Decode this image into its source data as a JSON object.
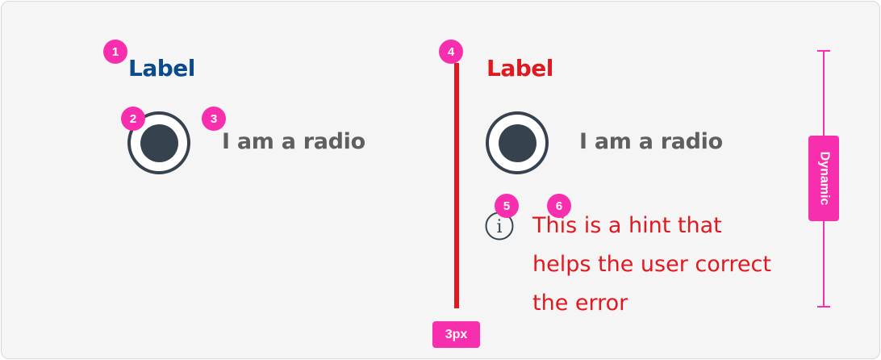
{
  "badges": [
    "1",
    "2",
    "3",
    "4",
    "5",
    "6"
  ],
  "default_state": {
    "label": "Label",
    "radio_text": "I am a radio"
  },
  "error_state": {
    "label": "Label",
    "radio_text": "I am a radio",
    "hint_icon": "info-icon",
    "hint_icon_glyph": "i",
    "hint_lines": [
      "This is a hint that",
      "helps the user correct",
      "the error"
    ]
  },
  "annotations": {
    "bar_width_tag": "3px",
    "height_tag": "Dynamic"
  },
  "colors": {
    "badge": "#f72fae",
    "default_label": "#0b4a8b",
    "error": "#e1191f",
    "radio": "#36434f",
    "radio_text": "#5f5f5f",
    "background": "#f5f5f5"
  }
}
